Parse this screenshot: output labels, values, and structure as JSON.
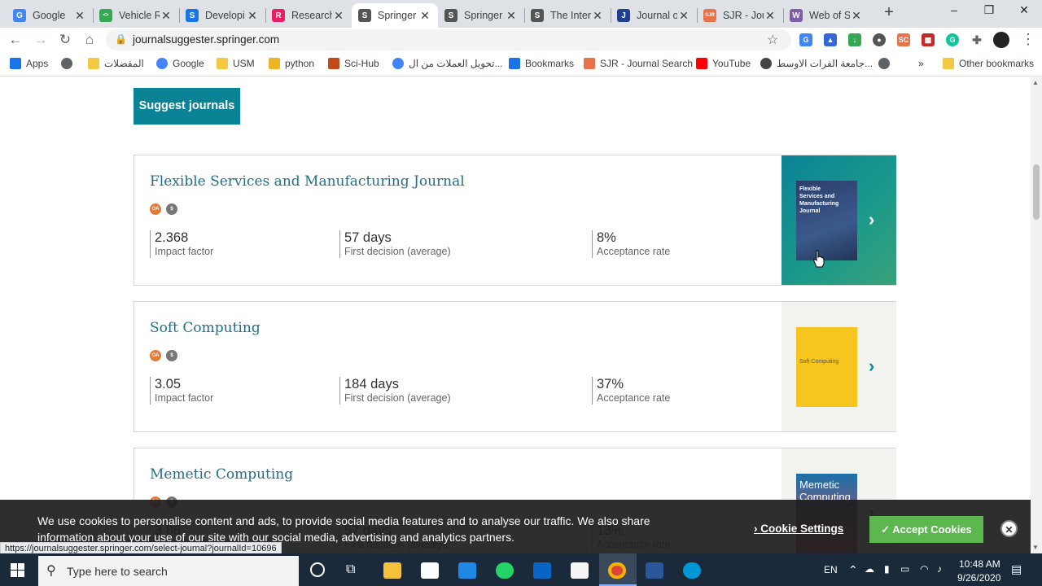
{
  "tabs": [
    {
      "title": "Google",
      "icon": "google-icon",
      "color": "#4285f4",
      "glyph": "G"
    },
    {
      "title": "Vehicle R",
      "icon": "vehicle-icon",
      "color": "#34a853",
      "glyph": "<>"
    },
    {
      "title": "Developi",
      "icon": "developer-icon",
      "color": "#1a73e8",
      "glyph": "S"
    },
    {
      "title": "Research",
      "icon": "research-icon",
      "color": "#e91e63",
      "glyph": "R"
    },
    {
      "title": "Springer",
      "icon": "springer-icon",
      "color": "#555555",
      "glyph": "S",
      "active": true
    },
    {
      "title": "Springer",
      "icon": "springer-icon",
      "color": "#555555",
      "glyph": "S"
    },
    {
      "title": "The Inter",
      "icon": "springer-icon",
      "color": "#555555",
      "glyph": "S"
    },
    {
      "title": "Journal o",
      "icon": "journal-icon",
      "color": "#1f3f8f",
      "glyph": "J"
    },
    {
      "title": "SJR - Jou",
      "icon": "sjr-icon",
      "color": "#e8734a",
      "glyph": "SJR"
    },
    {
      "title": "Web of S",
      "icon": "wos-icon",
      "color": "#7b5ea7",
      "glyph": "W"
    }
  ],
  "address": {
    "url": "journalsuggester.springer.com"
  },
  "bookmarks": [
    {
      "label": "Apps",
      "kind": "apps"
    },
    {
      "label": "",
      "kind": "globe"
    },
    {
      "label": "المفضلات",
      "kind": "folder"
    },
    {
      "label": "Google",
      "kind": "google"
    },
    {
      "label": "USM",
      "kind": "folder"
    },
    {
      "label": "python",
      "kind": "python"
    },
    {
      "label": "Sci-Hub",
      "kind": "scihub"
    },
    {
      "label": "تحويل العملات من ال...",
      "kind": "google"
    },
    {
      "label": "Bookmarks",
      "kind": "star"
    },
    {
      "label": "SJR - Journal Search",
      "kind": "sjr"
    },
    {
      "label": "YouTube",
      "kind": "youtube"
    },
    {
      "label": "جامعة الفرات الاوسط...",
      "kind": "uni"
    },
    {
      "label": "",
      "kind": "globe"
    },
    {
      "label": "»",
      "kind": "more"
    },
    {
      "label": "Other bookmarks",
      "kind": "folder"
    }
  ],
  "page": {
    "suggest_button": "Suggest journals",
    "journals": [
      {
        "title": "Flexible Services and Manufacturing Journal",
        "badges": [
          "OA",
          "$"
        ],
        "impact_factor": "2.368",
        "impact_label": "Impact factor",
        "decision": "57 days",
        "decision_label": "First decision (average)",
        "acceptance": "8%",
        "acceptance_label": "Acceptance rate",
        "highlight": true,
        "cover_lines": [
          "Flexible",
          "Services and",
          "Manufacturing",
          "Journal"
        ]
      },
      {
        "title": "Soft Computing",
        "badges": [
          "OA",
          "$"
        ],
        "impact_factor": "3.05",
        "impact_label": "Impact factor",
        "decision": "184 days",
        "decision_label": "First decision (average)",
        "acceptance": "37%",
        "acceptance_label": "Acceptance rate",
        "highlight": false,
        "cover_lines": [
          "Soft Computing"
        ]
      },
      {
        "title": "Memetic Computing",
        "badges": [
          "OA",
          "$"
        ],
        "impact_factor": "3.86",
        "impact_label": "Impact factor",
        "decision": "57 days",
        "decision_label": "First decision (average)",
        "acceptance": "13%",
        "acceptance_label": "Acceptance rate",
        "highlight": false,
        "cover_lines": [
          "Memetic",
          "Computing"
        ]
      }
    ]
  },
  "cookie": {
    "text": "We use cookies to personalise content and ads, to provide social media features and to analyse our traffic. We also share information about your use of our site with our social media, advertising and analytics partners.",
    "settings": "Cookie Settings",
    "accept": "✓ Accept Cookies"
  },
  "status_url": "https://journalsuggester.springer.com/select-journal?journalId=10696",
  "taskbar": {
    "search_placeholder": "Type here to search",
    "lang": "EN",
    "time": "10:48 AM",
    "date": "9/26/2020"
  },
  "colors": {
    "accent": "#0b8396",
    "title": "#1f6f8b",
    "accept": "#5bb74e"
  }
}
